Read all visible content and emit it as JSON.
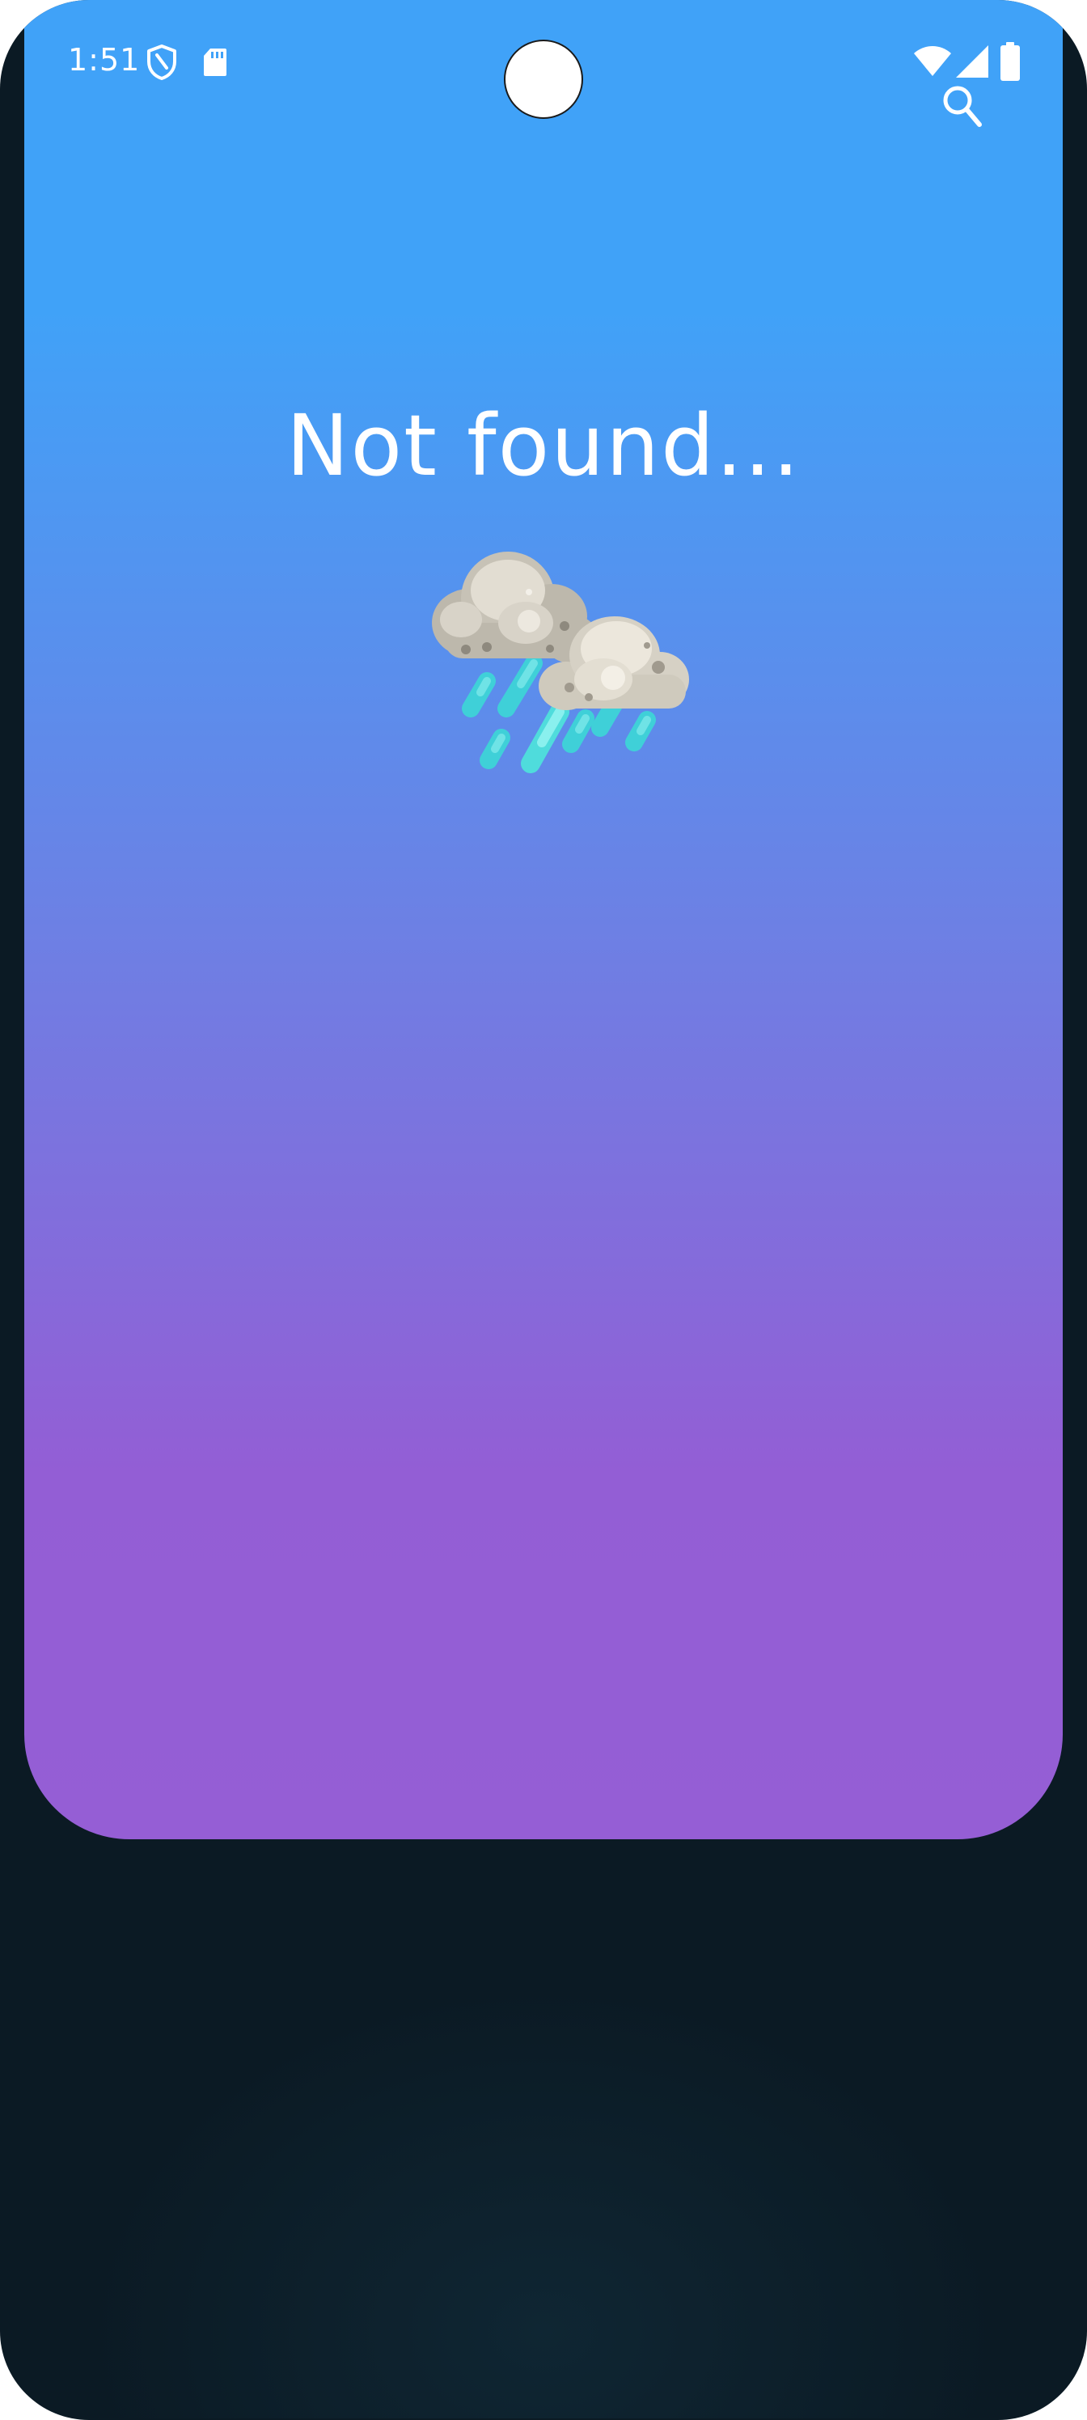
{
  "status_bar": {
    "time": "1:51",
    "icons": [
      "shield-icon",
      "sdcard-icon",
      "wifi-icon",
      "signal-icon",
      "battery-icon"
    ]
  },
  "toolbar": {
    "search_icon": "search-icon"
  },
  "main": {
    "message": "Not found...",
    "illustration": "rain-cloud-icon"
  },
  "colors": {
    "gradient_top": "#40a2f8",
    "gradient_mid": "#6d80e4",
    "gradient_bottom": "#955ed5",
    "device_frame": "#0b1a24",
    "text": "#ffffff"
  }
}
